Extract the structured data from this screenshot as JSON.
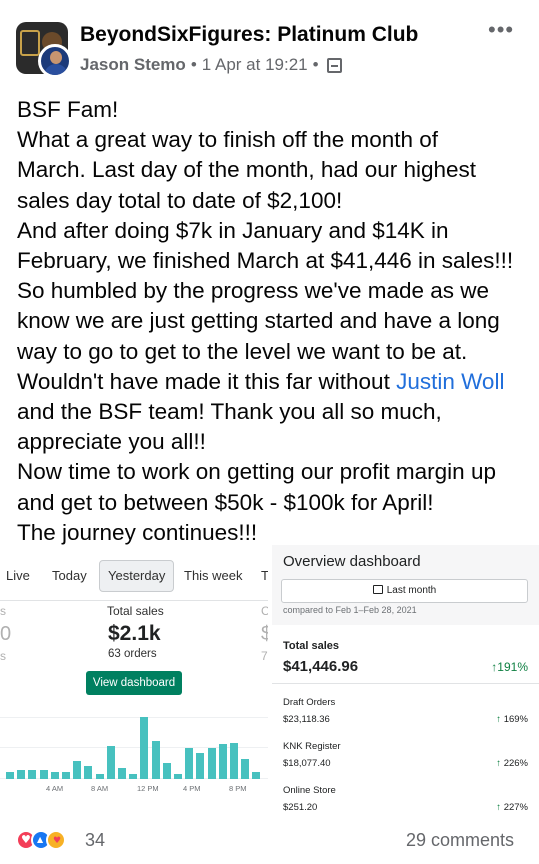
{
  "header": {
    "group_name": "BeyondSixFigures: Platinum Club",
    "author": "Jason Stemo",
    "timestamp": "1 Apr at 19:21",
    "more_icon": "more-icon",
    "privacy_icon": "group-privacy-icon"
  },
  "post": {
    "lines": [
      "BSF Fam!",
      "What a great way to finish off the month of",
      "March.  Last day of the month, had our highest",
      "sales day total to date of $2,100!",
      "And after doing $7k in January and $14K in",
      "February, we finished March at $41,446 in sales!!!",
      "So humbled by the progress we've made as we",
      "know we are just getting started and have a long",
      "way to go to get to the level we want to be at."
    ],
    "line_before_mention": "Wouldn't have made it this far without ",
    "mention": "Justin Woll",
    "lines_after": [
      "and the BSF team!  Thank you all so much,",
      "appreciate you all!!",
      "Now time to work on getting our profit margin up",
      "and get to between $50k - $100k for April!",
      "The journey continues!!!"
    ]
  },
  "left_screenshot": {
    "tabs": [
      "Live",
      "Today",
      "Yesterday",
      "This week",
      "T"
    ],
    "active_tab": "Yesterday",
    "ghost_left": [
      "s",
      "0",
      "s"
    ],
    "ghost_right": [
      "C",
      "$",
      "7"
    ],
    "total_sales_label": "Total sales",
    "total_sales_value": "$2.1k",
    "orders": "63 orders",
    "view_button": "View dashboard",
    "chart_data": {
      "type": "bar",
      "x_tick_labels": [
        "4 AM",
        "8 AM",
        "12 PM",
        "4 PM",
        "8 PM"
      ],
      "values": [
        2,
        2.5,
        2.5,
        2.5,
        2,
        2,
        5,
        3.5,
        1.5,
        9,
        3,
        1.5,
        17,
        10.5,
        4.5,
        1.5,
        8.5,
        7,
        8.5,
        9.5,
        10,
        5.5,
        2
      ],
      "color": "#47c1bf"
    }
  },
  "right_screenshot": {
    "title": "Overview dashboard",
    "date_button": "Last month",
    "compare_text": "compared to Feb 1–Feb 28, 2021",
    "total_label": "Total sales",
    "total_value": "$41,446.96",
    "total_pct": "↑191%",
    "rows": [
      {
        "label": "Draft Orders",
        "value": "$23,118.36",
        "pct": "169%"
      },
      {
        "label": "KNK Register",
        "value": "$18,077.40",
        "pct": "226%"
      },
      {
        "label": "Online Store",
        "value": "$251.20",
        "pct": "227%"
      }
    ],
    "up_arrow": "↑"
  },
  "footer": {
    "reaction_count": "34",
    "comments": "29 comments"
  }
}
